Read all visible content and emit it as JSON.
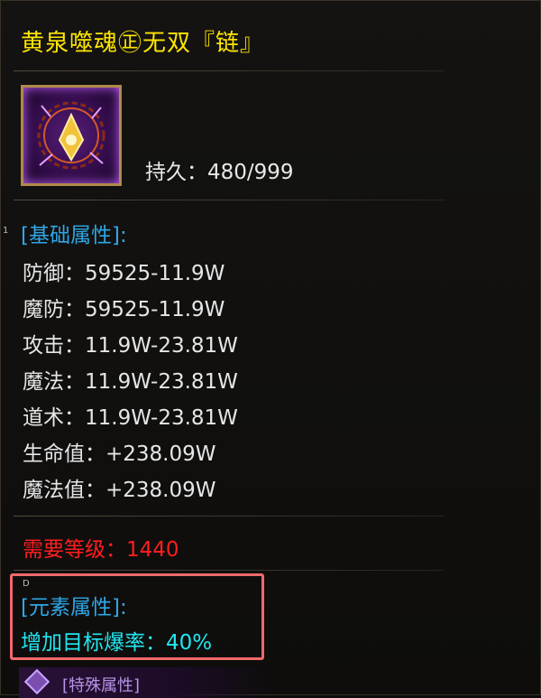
{
  "item": {
    "name": "黄泉噬魂㊣无双『链』",
    "durability": "持久：480/999"
  },
  "side_marks": {
    "left": "1",
    "elem": "D"
  },
  "base_section": {
    "header": "[基础属性]:",
    "stats": [
      "防御：59525-11.9W",
      "魔防：59525-11.9W",
      "攻击：11.9W-23.81W",
      "魔法：11.9W-23.81W",
      "道术：11.9W-23.81W",
      "生命值：+238.09W",
      "魔法值：+238.09W"
    ]
  },
  "requirement": "需要等级：1440",
  "element_section": {
    "header": "[元素属性]:",
    "stat": "增加目标爆率：40%"
  },
  "special_section": {
    "label": "[特殊属性]"
  },
  "colors": {
    "title": "#ffe600",
    "section_header": "#2fa6e6",
    "requirement": "#ff1e1e",
    "element_stat": "#22e6f0",
    "highlight_border": "#f06a6a"
  },
  "icons": {
    "item": "necklace-icon",
    "special": "diamond-icon"
  }
}
